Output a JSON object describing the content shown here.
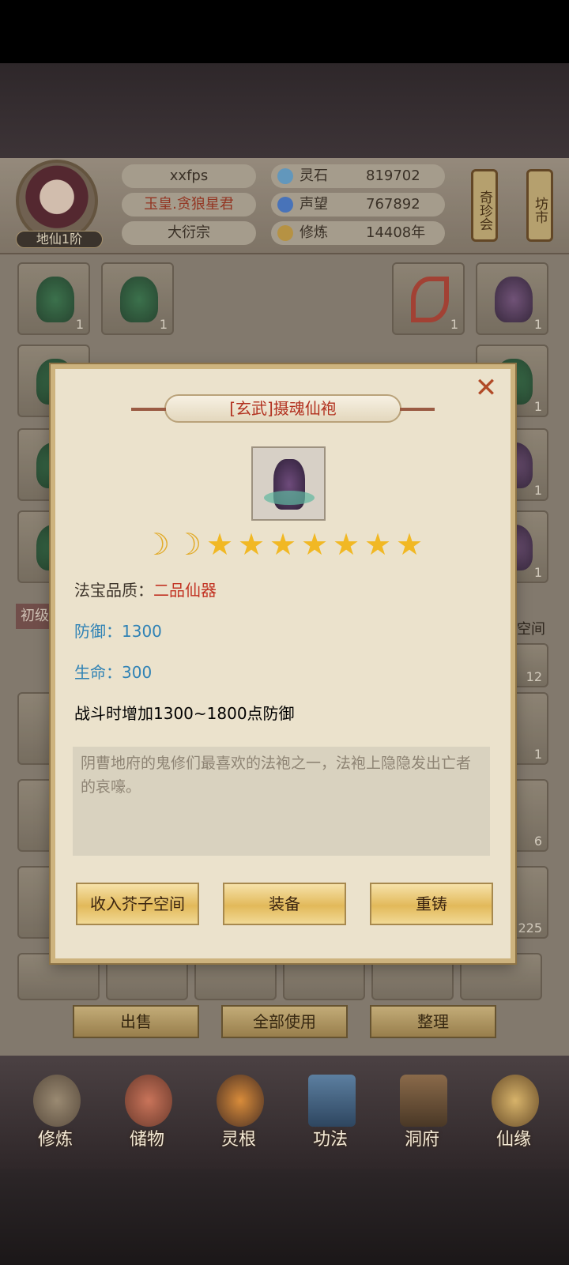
{
  "header": {
    "realm": "地仙1阶",
    "name": "xxfps",
    "title": "玉皇.贪狼星君",
    "sect": "大衍宗",
    "resources": [
      {
        "icon": "spirit-stone-icon",
        "label": "灵石",
        "value": "819702",
        "color": "#6aa8d4"
      },
      {
        "icon": "reputation-icon",
        "label": "声望",
        "value": "767892",
        "color": "#4d7fd1"
      },
      {
        "icon": "cultivation-icon",
        "label": "修炼",
        "value": "14408年",
        "color": "#caa24b"
      }
    ],
    "scroll_buttons": [
      "奇珍会",
      "坊市"
    ]
  },
  "background": {
    "left_label": "初级",
    "right_label": "子空间",
    "counts": [
      "1",
      "1",
      "1",
      "1",
      "1",
      "1",
      "1",
      "12",
      "1",
      "6",
      "225"
    ]
  },
  "bottom_buttons": [
    "出售",
    "全部使用",
    "整理"
  ],
  "nav": [
    "修炼",
    "储物",
    "灵根",
    "功法",
    "洞府",
    "仙缘"
  ],
  "modal": {
    "close": "✕",
    "title": "[玄武]摄魂仙袍",
    "moons": 2,
    "stars": 7,
    "quality_label": "法宝品质：",
    "quality_value": "二品仙器",
    "defense_label": "防御：",
    "defense_value": "1300",
    "hp_label": "生命：",
    "hp_value": "300",
    "effect": "战斗时增加1300~1800点防御",
    "description": "阴曹地府的鬼修们最喜欢的法袍之一，法袍上隐隐发出亡者的哀嚎。",
    "buttons": [
      "收入芥子空间",
      "装备",
      "重铸"
    ]
  }
}
